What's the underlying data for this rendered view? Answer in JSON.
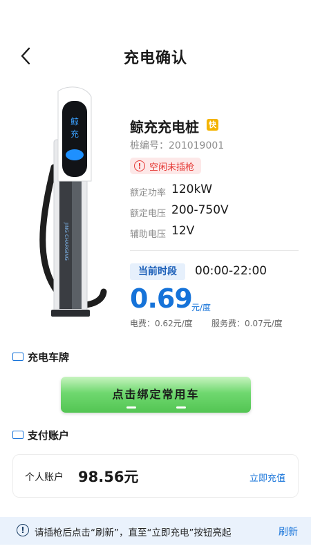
{
  "header": {
    "title": "充电确认"
  },
  "charger": {
    "name": "鲸充充电桩",
    "fast_badge": "快",
    "code_label": "桩编号：",
    "code": "201019001",
    "status": "空闲未插枪",
    "specs": [
      {
        "label": "额定功率",
        "value": "120kW"
      },
      {
        "label": "额定电压",
        "value": "200-750V"
      },
      {
        "label": "辅助电压",
        "value": "12V"
      }
    ],
    "period_label": "当前时段",
    "period_time": "00:00-22:00",
    "price": "0.69",
    "price_unit": "元/度",
    "electric_fee": "电费：0.62元/度",
    "service_fee": "服务费：0.07元/度",
    "device_logo_text": "鲸充",
    "device_brand_text": "JING CHARGING"
  },
  "plate": {
    "section_title": "充电车牌",
    "bind_button": "点击绑定常用车"
  },
  "payment": {
    "section_title": "支付账户",
    "account_label": "个人账户",
    "balance": "98.56元",
    "recharge": "立即充值"
  },
  "notice": {
    "text": "请插枪后点击“刷新”，直至“立即充电”按钮亮起",
    "refresh": "刷新"
  },
  "colors": {
    "accent": "#1673d9",
    "status_red": "#e53935",
    "button_green": "#6fd86f",
    "badge_yellow": "#f4b400"
  }
}
